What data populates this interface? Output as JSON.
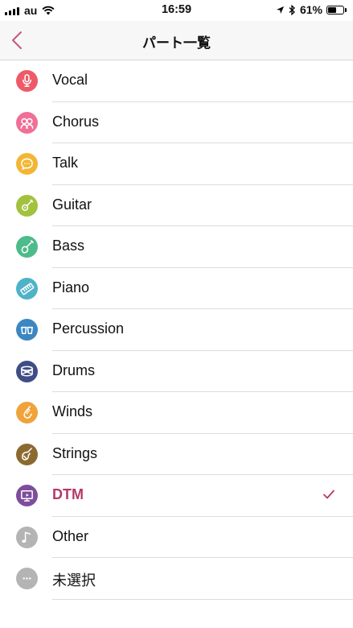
{
  "status_bar": {
    "carrier": "au",
    "time": "16:59",
    "battery_pct_label": "61%",
    "battery_level": 0.61
  },
  "nav": {
    "title": "パート一覧"
  },
  "parts": [
    {
      "label": "Vocal",
      "color": "#ee5a67",
      "icon": "microphone-icon",
      "selected": false
    },
    {
      "label": "Chorus",
      "color": "#f06f96",
      "icon": "chorus-faces-icon",
      "selected": false
    },
    {
      "label": "Talk",
      "color": "#f3b634",
      "icon": "speech-bubble-icon",
      "selected": false
    },
    {
      "label": "Guitar",
      "color": "#a2c23e",
      "icon": "guitar-icon",
      "selected": false
    },
    {
      "label": "Bass",
      "color": "#4dbb8a",
      "icon": "bass-icon",
      "selected": false
    },
    {
      "label": "Piano",
      "color": "#4fb3c8",
      "icon": "keyboard-icon",
      "selected": false
    },
    {
      "label": "Percussion",
      "color": "#3a87c3",
      "icon": "bongo-icon",
      "selected": false
    },
    {
      "label": "Drums",
      "color": "#3f4d86",
      "icon": "drum-icon",
      "selected": false
    },
    {
      "label": "Winds",
      "color": "#f0a33b",
      "icon": "saxophone-icon",
      "selected": false
    },
    {
      "label": "Strings",
      "color": "#8c6a2f",
      "icon": "violin-icon",
      "selected": false
    },
    {
      "label": "DTM",
      "color": "#7e4d9c",
      "icon": "monitor-icon",
      "selected": true
    },
    {
      "label": "Other",
      "color": "#b4b4b4",
      "icon": "music-note-icon",
      "selected": false
    },
    {
      "label": "未選択",
      "color": "#b4b4b4",
      "icon": "ellipsis-icon",
      "selected": false
    }
  ],
  "accent_color": "#b5386b"
}
